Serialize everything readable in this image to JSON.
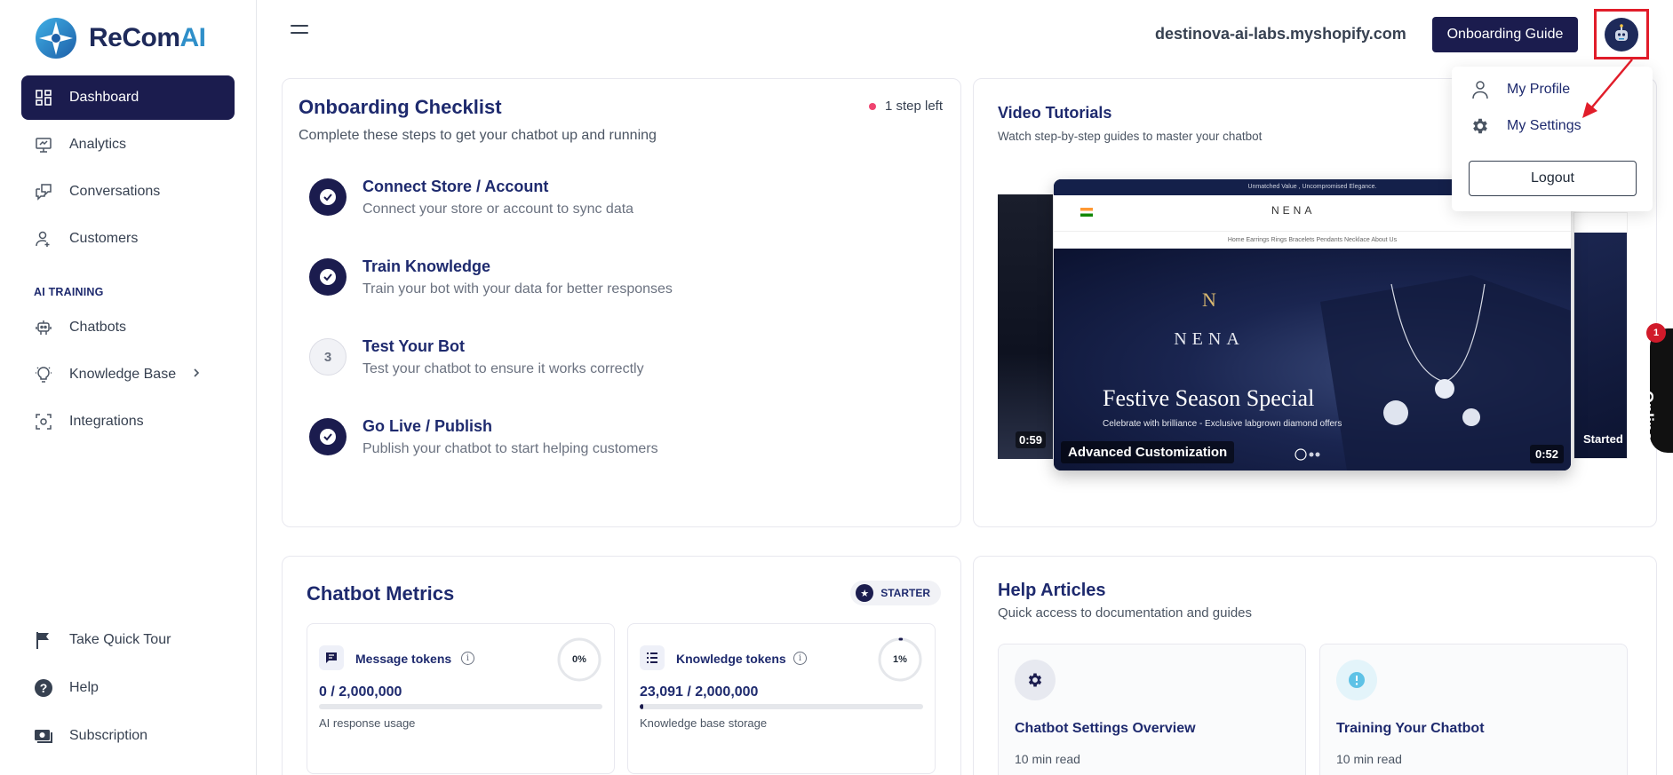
{
  "brand": {
    "name_main": "ReCom",
    "name_accent": "AI"
  },
  "sidebar": {
    "items": [
      {
        "label": "Dashboard",
        "icon": "dashboard-icon",
        "active": true
      },
      {
        "label": "Analytics",
        "icon": "analytics-icon"
      },
      {
        "label": "Conversations",
        "icon": "conversations-icon"
      },
      {
        "label": "Customers",
        "icon": "customers-icon"
      }
    ],
    "section_label": "AI TRAINING",
    "training_items": [
      {
        "label": "Chatbots",
        "icon": "chatbot-icon"
      },
      {
        "label": "Knowledge Base",
        "icon": "bulb-icon"
      },
      {
        "label": "Integrations",
        "icon": "integrations-icon"
      }
    ],
    "bottom_items": [
      {
        "label": "Take Quick Tour",
        "icon": "flag-icon"
      },
      {
        "label": "Help",
        "icon": "help-icon"
      },
      {
        "label": "Subscription",
        "icon": "subscription-icon"
      }
    ]
  },
  "header": {
    "shop_url": "destinova-ai-labs.myshopify.com",
    "guide_button": "Onboarding Guide"
  },
  "profile_menu": {
    "my_profile": "My Profile",
    "my_settings": "My Settings",
    "logout": "Logout"
  },
  "checklist": {
    "title": "Onboarding Checklist",
    "subtitle": "Complete these steps to get your chatbot up and running",
    "status": "1 step left",
    "steps": [
      {
        "title": "Connect Store / Account",
        "desc": "Connect your store or account to sync data",
        "done": true
      },
      {
        "title": "Train Knowledge",
        "desc": "Train your bot with your data for better responses",
        "done": true
      },
      {
        "title": "Test Your Bot",
        "desc": "Test your chatbot to ensure it works correctly",
        "done": false,
        "number": "3"
      },
      {
        "title": "Go Live / Publish",
        "desc": "Publish your chatbot to start helping customers",
        "done": true
      }
    ]
  },
  "videos": {
    "title": "Video Tutorials",
    "subtitle": "Watch step-by-step guides to master your chatbot",
    "main": {
      "caption": "Advanced Customization",
      "duration": "0:52",
      "banner": "Unmatched Value , Uncompromised Elegance.",
      "store_name": "NENA",
      "nav_links": "Home    Earrings    Rings    Bracelets    Pendants    Necklace    About Us",
      "hero_heading": "Festive Season Special",
      "hero_sub": "Celebrate with brilliance - Exclusive labgrown diamond offers"
    },
    "left": {
      "duration": "0:59"
    },
    "right": {
      "caption": "Started"
    }
  },
  "metrics": {
    "title": "Chatbot Metrics",
    "plan": "STARTER",
    "message": {
      "label": "Message tokens",
      "percent": "0%",
      "value": "0 / 2,000,000",
      "desc": "AI response usage",
      "fill": 0
    },
    "knowledge": {
      "label": "Knowledge tokens",
      "percent": "1%",
      "value": "23,091 / 2,000,000",
      "desc": "Knowledge base storage",
      "fill": 1.15
    }
  },
  "help": {
    "title": "Help Articles",
    "subtitle": "Quick access to documentation and guides",
    "articles": [
      {
        "title": "Chatbot Settings Overview",
        "meta": "10 min read",
        "icon": "gear-icon"
      },
      {
        "title": "Training Your Chatbot",
        "meta": "10 min read",
        "icon": "info-icon"
      }
    ]
  },
  "chat_widget": {
    "label": "Online",
    "badge": "1"
  },
  "colors": {
    "primary": "#1b1c4e",
    "accent": "#2f8fc9",
    "highlight": "#e11d2a"
  }
}
